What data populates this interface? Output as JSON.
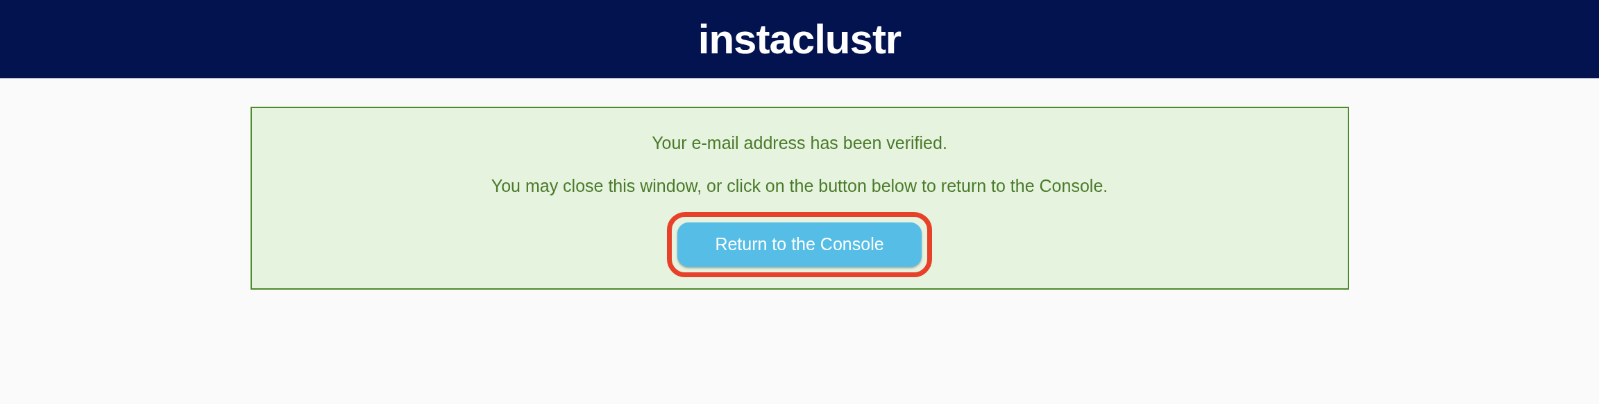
{
  "header": {
    "logo": "instaclustr"
  },
  "notice": {
    "messages": [
      "Your e-mail address has been verified.",
      "You may close this window, or click on the button below to return to the Console."
    ],
    "button": {
      "label": "Return to the Console",
      "highlighted": true
    }
  }
}
